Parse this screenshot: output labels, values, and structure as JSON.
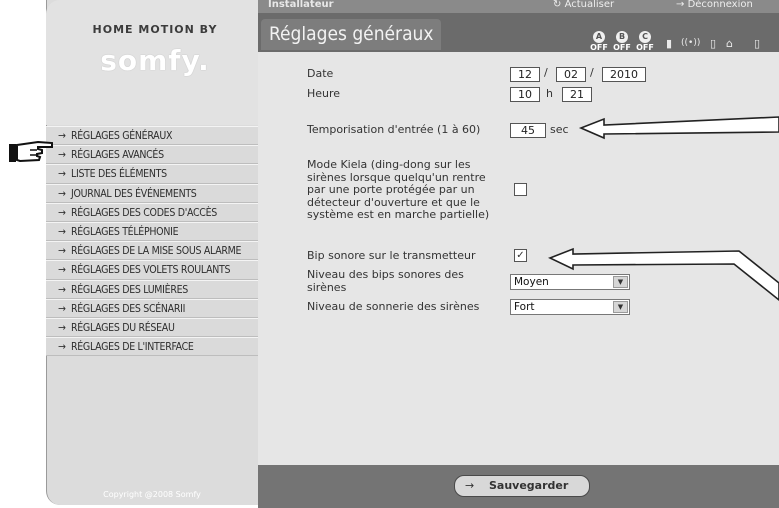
{
  "brand": {
    "top": "HOME MOTION BY",
    "logo": "somfy."
  },
  "topbar": {
    "user": "Installateur",
    "refresh": "Actualiser",
    "logout": "Déconnexion"
  },
  "title": "Réglages généraux",
  "alarm_zones": [
    {
      "letter": "A",
      "state": "OFF"
    },
    {
      "letter": "B",
      "state": "OFF"
    },
    {
      "letter": "C",
      "state": "OFF"
    }
  ],
  "status_icons": [
    "battery-icon",
    "radio-signal-icon",
    "battery-empty-icon",
    "house-ok-icon",
    "door-icon"
  ],
  "menu": {
    "arrow": "→",
    "items": [
      "RÉGLAGES GÉNÉRAUX",
      "RÉGLAGES AVANCÉS",
      "LISTE DES ÉLÉMENTS",
      "JOURNAL DES ÉVÉNEMENTS",
      "RÉGLAGES DES CODES D'ACCÈS",
      "RÉGLAGES TÉLÉPHONIE",
      "RÉGLAGES DE LA MISE SOUS ALARME",
      "RÉGLAGES DES VOLETS ROULANTS",
      "RÉGLAGES DES LUMIÈRES",
      "RÉGLAGES DES SCÉNARII",
      "RÉGLAGES DU RÉSEAU",
      "RÉGLAGES DE L'INTERFACE"
    ]
  },
  "copyright": "Copyright @2008 Somfy",
  "form": {
    "date_label": "Date",
    "date": {
      "day": "12",
      "month": "02",
      "year": "2010",
      "sep": "/"
    },
    "time_label": "Heure",
    "time": {
      "hour": "10",
      "hour_unit": "h",
      "minute": "21"
    },
    "delay_label": "Temporisation d'entrée (1 à 60)",
    "delay_value": "45",
    "delay_unit": "sec",
    "kiela_label_lines": [
      "Mode Kiela (ding-dong sur les",
      "sirènes lorsque quelqu'un rentre",
      "par une porte protégée par un",
      "détecteur d'ouverture et que le",
      "système est en marche partielle)"
    ],
    "kiela_checked": false,
    "beep_label": "Bip sonore sur le transmetteur",
    "beep_checked": true,
    "beep_check_glyph": "✓",
    "beep_level_label_lines": [
      "Niveau des bips sonores des",
      "sirènes"
    ],
    "beep_level_value": "Moyen",
    "ring_level_label": "Niveau de sonnerie des sirènes",
    "ring_level_value": "Fort",
    "dropdown_glyph": "▼"
  },
  "footer": {
    "arrow": "→",
    "save": "Sauvegarder"
  }
}
